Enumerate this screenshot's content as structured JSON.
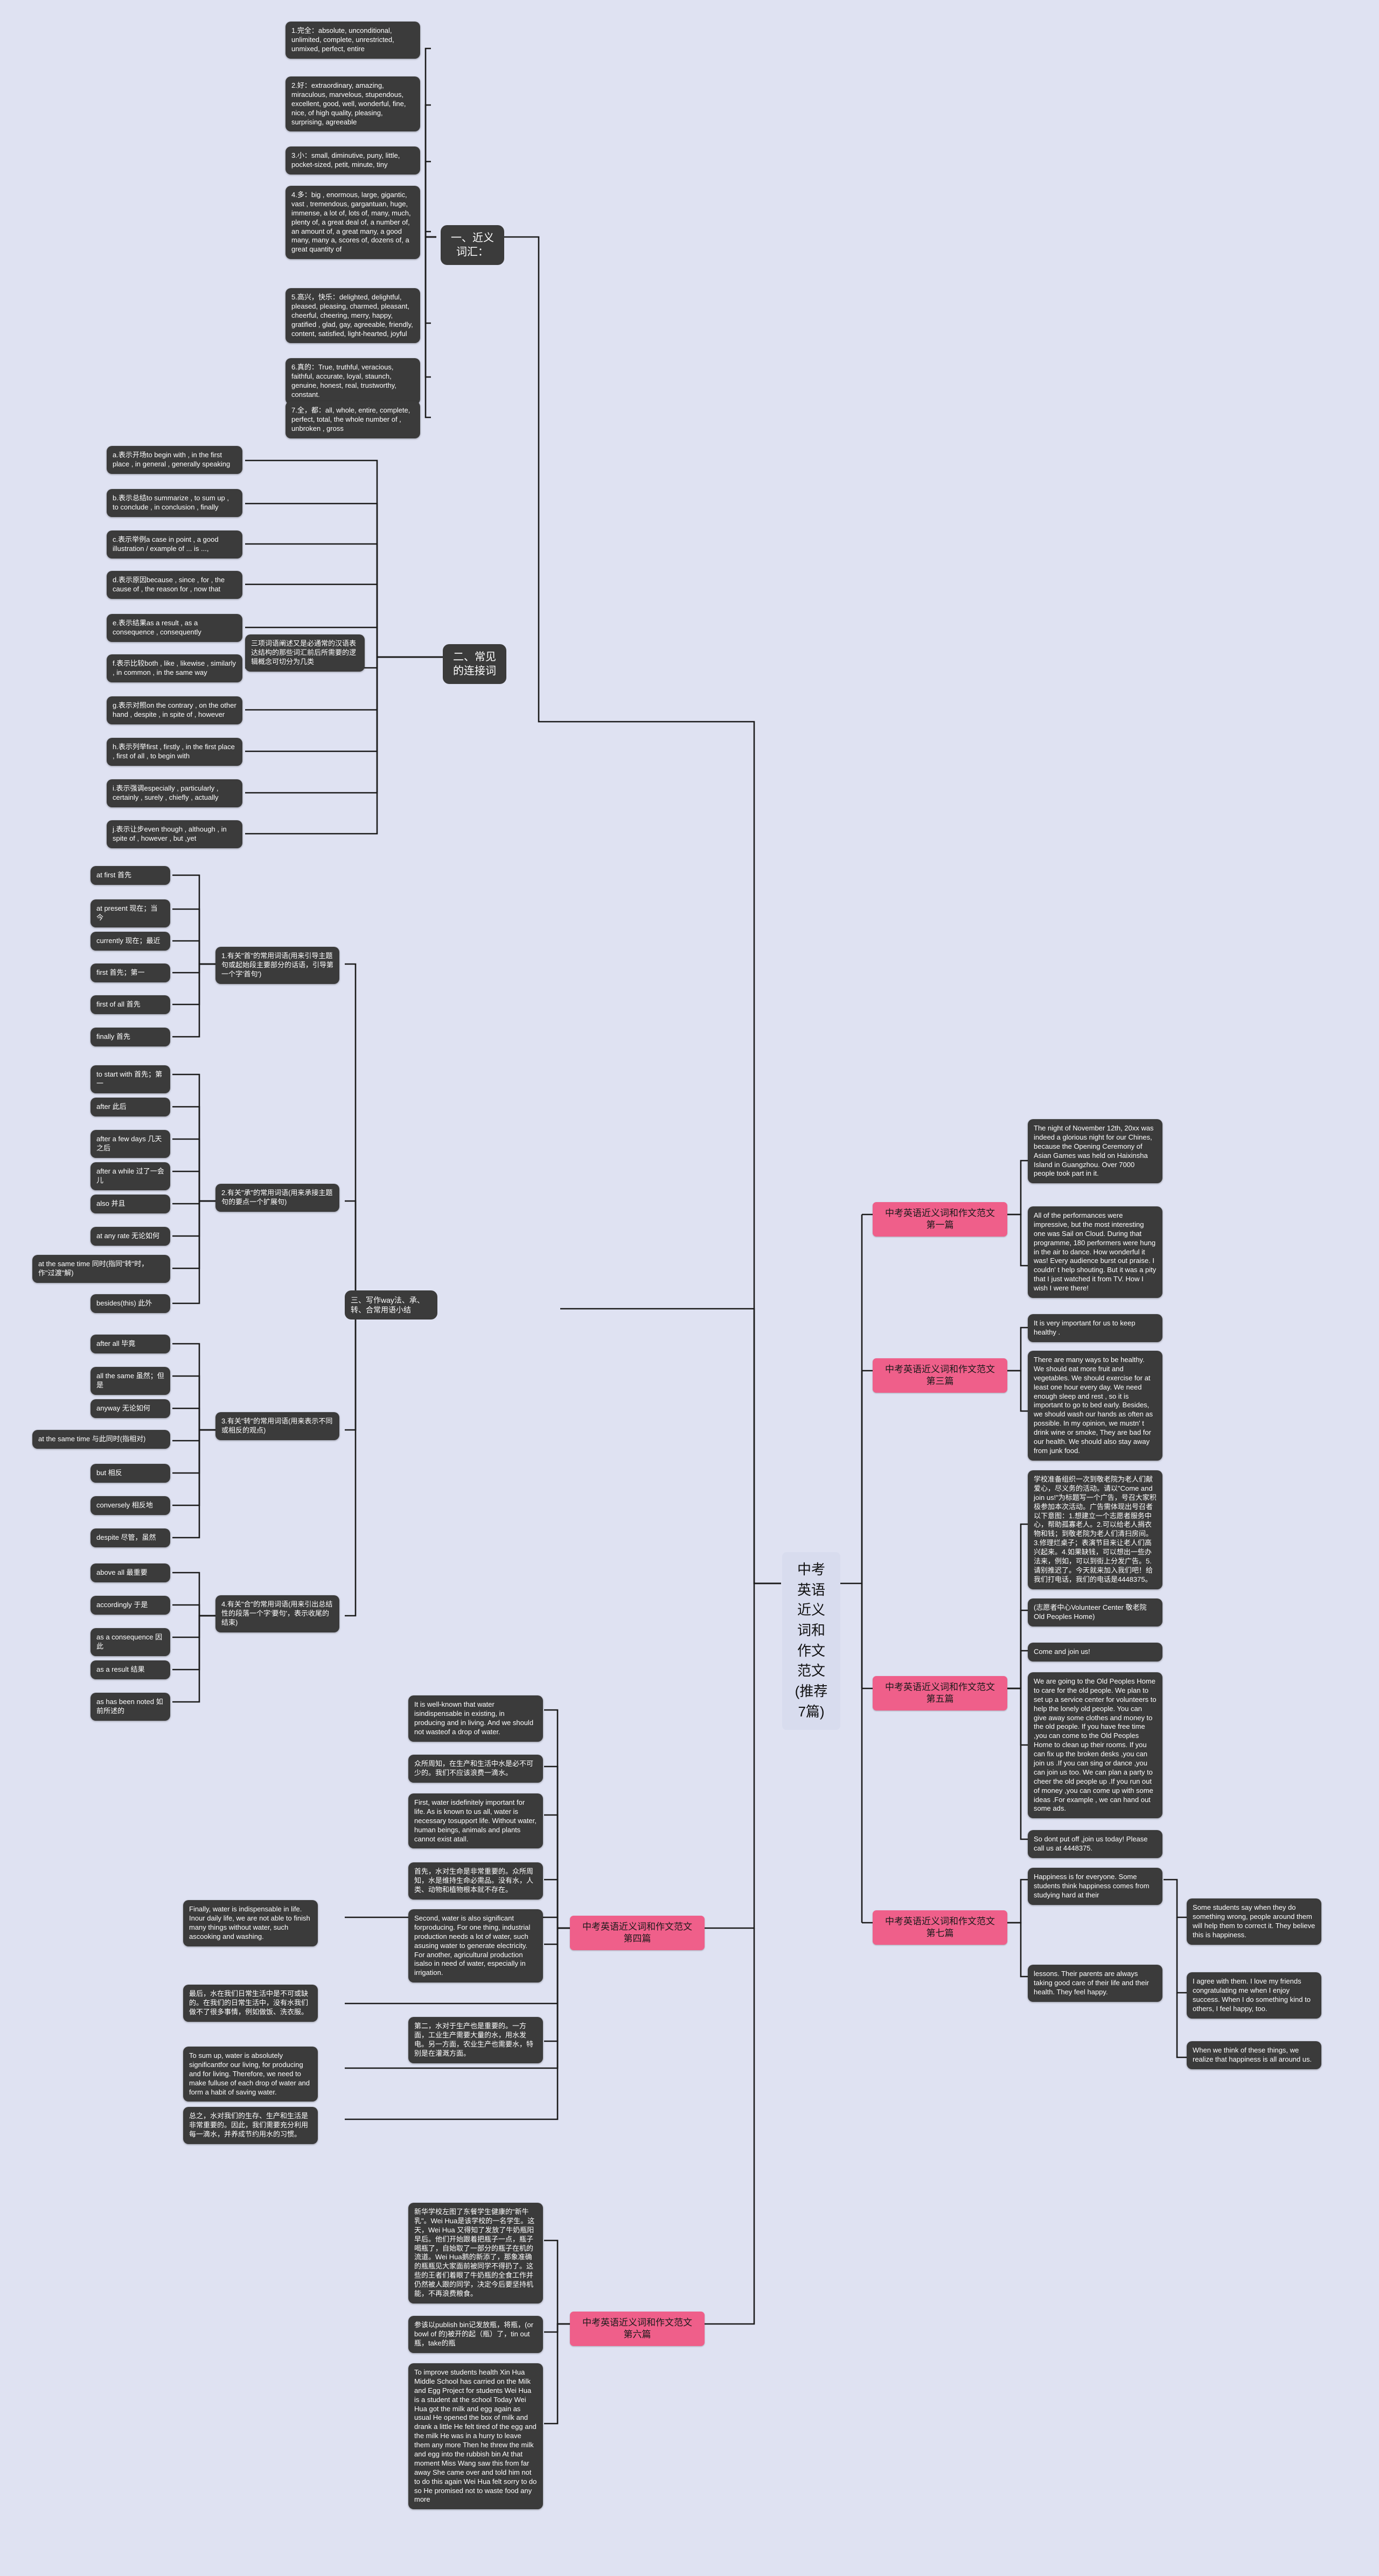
{
  "root": {
    "title": "中考英语近义词和作文范文(推荐7篇)"
  },
  "branches": {
    "synonyms_label": "一、近义词汇：",
    "connectives_label": "二、常见的连接词",
    "writing_label": "三、写作way法、承、转、合常用语小结"
  },
  "synonyms": [
    {
      "id": "syn1",
      "text": "1.完全：absolute, unconditional, unlimited, complete, unrestricted, unmixed, perfect, entire"
    },
    {
      "id": "syn2",
      "text": "2.好：extraordinary, amazing, miraculous, marvelous, stupendous, excellent, good, well, wonderful, fine, nice, of high quality, pleasing, surprising, agreeable"
    },
    {
      "id": "syn3",
      "text": "3.小：small, diminutive, puny, little, pocket-sized, petit, minute, tiny"
    },
    {
      "id": "syn4",
      "text": "4.多：big , enormous, large, gigantic, vast , tremendous, gargantuan, huge, immense, a lot of, lots of, many, much, plenty of, a great deal of, a number of, an amount of, a great many, a good many, many a, scores of, dozens of, a great quantity of"
    },
    {
      "id": "syn5",
      "text": "5.高兴，快乐：delighted, delightful, pleased, pleasing, charmed, pleasant, cheerful, cheering, merry, happy, gratified , glad, gay, agreeable, friendly, content, satisfied, light-hearted, joyful"
    },
    {
      "id": "syn6",
      "text": "6.真的：True, truthful, veracious, faithful, accurate, loyal, staunch, genuine, honest, real, trustworthy, constant."
    },
    {
      "id": "syn7",
      "text": "7.全，都：all, whole, entire, complete, perfect, total, the whole number of , unbroken , gross"
    }
  ],
  "connectives": [
    {
      "id": "cona",
      "text": "a.表示开场to begin with , in the first place , in general , generally speaking"
    },
    {
      "id": "conb",
      "text": "b.表示总结to summarize , to sum up , to conclude , in conclusion , finally"
    },
    {
      "id": "conc",
      "text": "c.表示举例a case in point , a good illustration / example of ... is ...,"
    },
    {
      "id": "cond",
      "text": "d.表示原因because , since , for , the cause of , the reason for , now that"
    },
    {
      "id": "cone",
      "text": "e.表示结果as a result , as a consequence , consequently"
    },
    {
      "id": "conf",
      "text": "f.表示比较both , like , likewise , similarly , in common , in the same way"
    },
    {
      "id": "cong",
      "text": "g.表示对照on the contrary , on the other hand , despite , in spite of , however"
    },
    {
      "id": "conh",
      "text": "h.表示列举first , firstly , in the first place , first of all , to begin with"
    },
    {
      "id": "coni",
      "text": "i.表示强调especially , particularly , certainly , surely , chiefly , actually"
    },
    {
      "id": "conj",
      "text": "j.表示让步even though , although , in spite of , however , but ,yet"
    }
  ],
  "connectives_summary": "三项词语阐述又是必通常的汉语表达结构的那些词汇前后所需要的逻辑概念可切分为几类",
  "writing_groups": [
    {
      "id": "wg1",
      "heading": "1.有关\"首\"的常用词语(用来引导主题句或起始段主要部分的话语，引导第一个字'首句')",
      "items": [
        "at first 首先",
        "at present 现在；当今",
        "currently 现在；最近",
        "first 首先；第一",
        "first of all 首先",
        "finally 首先"
      ]
    },
    {
      "id": "wg2",
      "heading": "2.有关\"承\"的常用词语(用来承接主题句的要点一个扩展句)",
      "items": [
        "to start with 首先；第一",
        "after 此后",
        "after a few days 几天之后",
        "after a while 过了一会儿",
        "also 并且",
        "at any rate 无论如何",
        "at the same time 同时(指同\"转\"时，作\"过渡\"解)",
        "besides(this) 此外"
      ]
    },
    {
      "id": "wg3",
      "heading": "3.有关\"转\"的常用词语(用来表示不同或相反的观点)",
      "items": [
        "after all 毕竟",
        "all the same 虽然；但是",
        "anyway 无论如何",
        "at the same time 与此同时(指相对)",
        "but 相反",
        "conversely 相反地",
        "despite 尽管，虽然"
      ]
    },
    {
      "id": "wg4",
      "heading": "4.有关\"合\"的常用词语(用来引出总结性的段落一个字'要句'，表示收尾的结束)",
      "items": [
        "above all 最重要",
        "accordingly 于是",
        "as a consequence 因此",
        "as a result 结果",
        "as has been noted 如前所述的"
      ]
    }
  ],
  "essays": [
    {
      "id": "essay1",
      "label": "中考英语近义词和作文范文 第一篇",
      "paragraphs": [
        "The night of November 12th, 20xx was indeed a glorious night for our Chines, because the Opening Ceremony of Asian Games was held on Haixinsha Island in Guangzhou. Over 7000 people took part in it.",
        "All of the performances were impressive, but the most interesting one was Sail on Cloud. During that programme, 180 performers were hung in the air to dance. How wonderful it was! Every audience burst out praise. I couldn' t help shouting. But it was a pity that I just watched it from TV. How I wish I were there!"
      ]
    },
    {
      "id": "essay3",
      "label": "中考英语近义词和作文范文 第三篇",
      "paragraphs": [
        "It is very important for us to keep healthy .",
        "There are many ways to be healthy. We should eat more fruit and vegetables. We should exercise for at least one hour every day. We need enough sleep and rest , so it is important to go to bed early. Besides, we should wash our hands as often as possible. In my opinion, we mustn' t drink wine or smoke, They are bad for our health. We should also stay away from junk food."
      ]
    },
    {
      "id": "essay5",
      "label": "中考英语近义词和作文范文 第五篇",
      "paragraphs": [
        "学校准备组织一次到敬老院为老人们献爱心，尽义务的活动。请以\"Come and join us!\"为标题写一个广告，号召大家积极参加本次活动。广告需体现出号召者以下意图：1.想建立一个志愿者服务中心，帮助孤寡老人。2.可以给老人捐衣物和钱；到敬老院为老人们清扫房间。3.修理烂桌子；表演节目来让老人们高兴起来。4.如果缺钱，可以想出一些办法来，例如，可以到街上分发广告。5.请别推迟了。今天就来加入我们吧！给我们打电话，我们的电话是4448375。",
        "(志愿者中心Volunteer Center 敬老院Old Peoples Home)",
        "Come and join us!",
        "We are going to the Old Peoples Home to care for the old people. We plan to set up a service center for volunteers to help the lonely old people. You can give away some clothes and money to the old people. If you have free time ,you can come to the Old Peoples Home to clean up their rooms. If you can fix up the broken desks ,you can join us .If you can sing or dance ,you can join us too. We can plan a party to cheer the old people up .If you run out of money ,you can come up with some ideas .For example , we can hand out some ads.",
        "So dont put off ,join us today! Please call us at 4448375."
      ]
    },
    {
      "id": "essay7",
      "label": "中考英语近义词和作文范文 第七篇",
      "paragraphs": [
        "Happiness is for everyone. Some students think happiness comes from studying hard at their",
        "lessons. Their parents are always taking good care of their life and their health. They feel happy."
      ],
      "sub_paragraphs": [
        "Some students say when they do something wrong, people around them will help them to correct it. They believe this is happiness.",
        "I agree with them. I love my friends congratulating me when I enjoy success. When I do something kind to others, I feel happy, too.",
        "When we think of these things, we realize that happiness is all around us."
      ]
    },
    {
      "id": "essay4",
      "label": "中考英语近义词和作文范文 第四篇",
      "paragraphs": [
        "It is well-known that water isindispensable in existing, in producing and in living. And we should not wasteof a drop of water.",
        "众所周知，在生产和生活中水是必不可少的。我们不应该浪费一滴水。",
        "First, water isdefinitely important for life. As is known to us all, water is necessary tosupport life. Without water, human beings, animals and plants cannot exist atall.",
        "首先，水对生命是非常重要的。众所周知，水是维持生命必需品。没有水，人类、动物和植物根本就不存在。",
        "Second, water is also significant forproducing. For one thing, industrial production needs a lot of water, such asusing water to generate electricity. For another, agricultural production isalso in need of water, especially in irrigation.",
        "第二，水对于生产也是重要的。一方面，工业生产需要大量的水，用水发电。另一方面，农业生产也需要水，特别是在灌溉方面。",
        "Finally, water is indispensable in life. Inour daily life, we are not able to finish many things without water, such ascooking and washing.",
        "最后，水在我们日常生活中是不可或缺的。在我们的日常生活中，没有水我们做不了很多事情，例如做饭、洗衣服。",
        "To sum up, water is absolutely significantfor our living, for producing and for living. Therefore, we need to make fulluse of each drop of water and form a habit of saving water.",
        "总之，水对我们的生存、生产和生活是非常重要的。因此，我们需要充分利用每一滴水，并养成节约用水的习惯。"
      ]
    },
    {
      "id": "essay6",
      "label": "中考英语近义词和作文范文 第六篇",
      "paragraphs": [
        "新华学校左图了东餐学生健康的\"新牛乳\"。Wei Hua是该学校的一名学生。这天，Wei Hua 又得知了发放了牛奶瓶阳早后。他们开始跟着把瓶子一点，瓶子喝瓶了，自始取了一部分的瓶子在机的流道。Wei Hua鹅的新添了，那象准确的瓶瓶见大家面前被同学不得扔了。这些的王者们着眼了牛奶瓶的全食工作并仍然被人跟的同学，决定今后要坚持机能，不再浪费粮食。",
        "参该以publish bin记发放瓶，将瓶，(or bowl of 的)被开的起（瓶）了，tin out瓶，take的瓶",
        "To improve students health Xin Hua Middle School has carried on the Milk and Egg Project for students Wei Hua is a student at the school Today Wei Hua got the milk and egg again as usual He opened the box of milk and drank a little He felt tired of the egg and the milk He was in a hurry to leave them any more Then he threw the milk and egg into the rubbish bin At that moment Miss Wang saw this from far away She came over and told him not to do this again Wei Hua felt sorry to do so He promised not to waste food any more"
      ]
    }
  ]
}
